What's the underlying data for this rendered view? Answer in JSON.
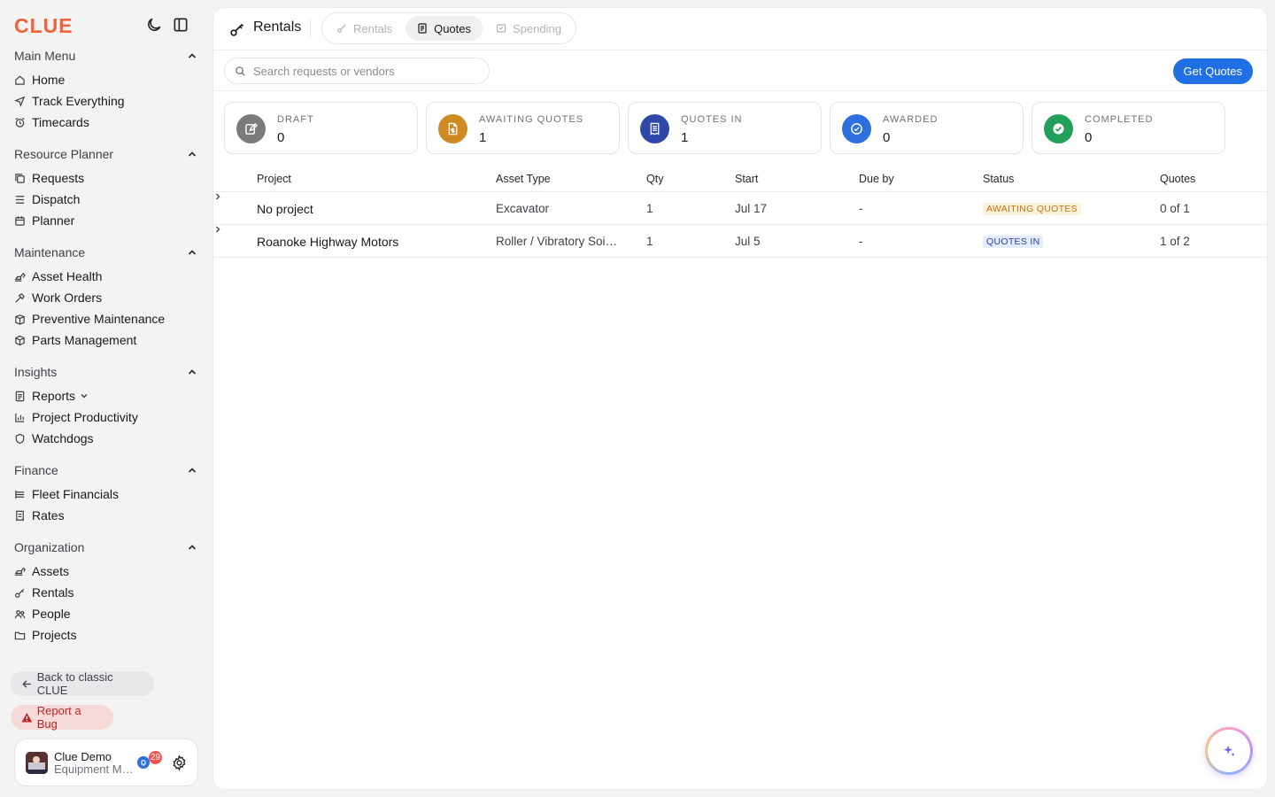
{
  "app": {
    "logo": "CLUE"
  },
  "sidebar": {
    "sections": [
      {
        "title": "Main Menu",
        "items": [
          {
            "label": "Home",
            "icon": "home-icon"
          },
          {
            "label": "Track Everything",
            "icon": "navigation-icon"
          },
          {
            "label": "Timecards",
            "icon": "alarm-clock-icon"
          }
        ]
      },
      {
        "title": "Resource Planner",
        "items": [
          {
            "label": "Requests",
            "icon": "copy-icon"
          },
          {
            "label": "Dispatch",
            "icon": "list-icon"
          },
          {
            "label": "Planner",
            "icon": "calendar-icon"
          }
        ]
      },
      {
        "title": "Maintenance",
        "items": [
          {
            "label": "Asset Health",
            "icon": "excavator-icon"
          },
          {
            "label": "Work Orders",
            "icon": "hammer-icon"
          },
          {
            "label": "Preventive Maintenance",
            "icon": "container-icon"
          },
          {
            "label": "Parts Management",
            "icon": "package-icon"
          }
        ]
      },
      {
        "title": "Insights",
        "items": [
          {
            "label": "Reports",
            "icon": "report-icon",
            "has_dropdown": true
          },
          {
            "label": "Project Productivity",
            "icon": "bar-chart-icon"
          },
          {
            "label": "Watchdogs",
            "icon": "shield-icon"
          }
        ]
      },
      {
        "title": "Finance",
        "items": [
          {
            "label": "Fleet Financials",
            "icon": "stack-icon"
          },
          {
            "label": "Rates",
            "icon": "receipt-icon"
          }
        ]
      },
      {
        "title": "Organization",
        "items": [
          {
            "label": "Assets",
            "icon": "loader-icon"
          },
          {
            "label": "Rentals",
            "icon": "key-icon"
          },
          {
            "label": "People",
            "icon": "users-icon"
          },
          {
            "label": "Projects",
            "icon": "folder-icon"
          }
        ]
      }
    ],
    "back_label": "Back to classic CLUE",
    "bug_label": "Report a Bug",
    "user": {
      "name": "Clue Demo",
      "role": "Equipment Manager",
      "notifications": "29"
    }
  },
  "header": {
    "title": "Rentals",
    "tabs": [
      {
        "label": "Rentals",
        "active": false
      },
      {
        "label": "Quotes",
        "active": true
      },
      {
        "label": "Spending",
        "active": false
      }
    ]
  },
  "search": {
    "placeholder": "Search requests or vendors",
    "value": ""
  },
  "actions": {
    "get_quotes": "Get Quotes"
  },
  "stats": [
    {
      "label": "DRAFT",
      "count": "0",
      "color": "#7a7a7a",
      "icon": "edit-icon"
    },
    {
      "label": "AWAITING QUOTES",
      "count": "1",
      "color": "#d08a22",
      "icon": "file-dollar-icon"
    },
    {
      "label": "QUOTES IN",
      "count": "1",
      "color": "#2f47a8",
      "icon": "receipt-icon"
    },
    {
      "label": "AWARDED",
      "count": "0",
      "color": "#2f6fe0",
      "icon": "check-circle-icon"
    },
    {
      "label": "COMPLETED",
      "count": "0",
      "color": "#22a05a",
      "icon": "check-circle-icon"
    }
  ],
  "table": {
    "columns": [
      "Project",
      "Asset Type",
      "Qty",
      "Start",
      "Due by",
      "Status",
      "Quotes"
    ],
    "rows": [
      {
        "project": "No project",
        "asset_type": "Excavator",
        "qty": "1",
        "start": "Jul 17",
        "due_by": "-",
        "status": "AWAITING QUOTES",
        "quotes": "0 of 1"
      },
      {
        "project": "Roanoke Highway Motors",
        "asset_type": "Roller / Vibratory Soil Compactor",
        "qty": "1",
        "start": "Jul 5",
        "due_by": "-",
        "status": "QUOTES IN",
        "quotes": "1 of 2"
      }
    ]
  },
  "colors": {
    "accent": "#1f6fe5",
    "brand": "#f0643c",
    "danger": "#c12424"
  }
}
